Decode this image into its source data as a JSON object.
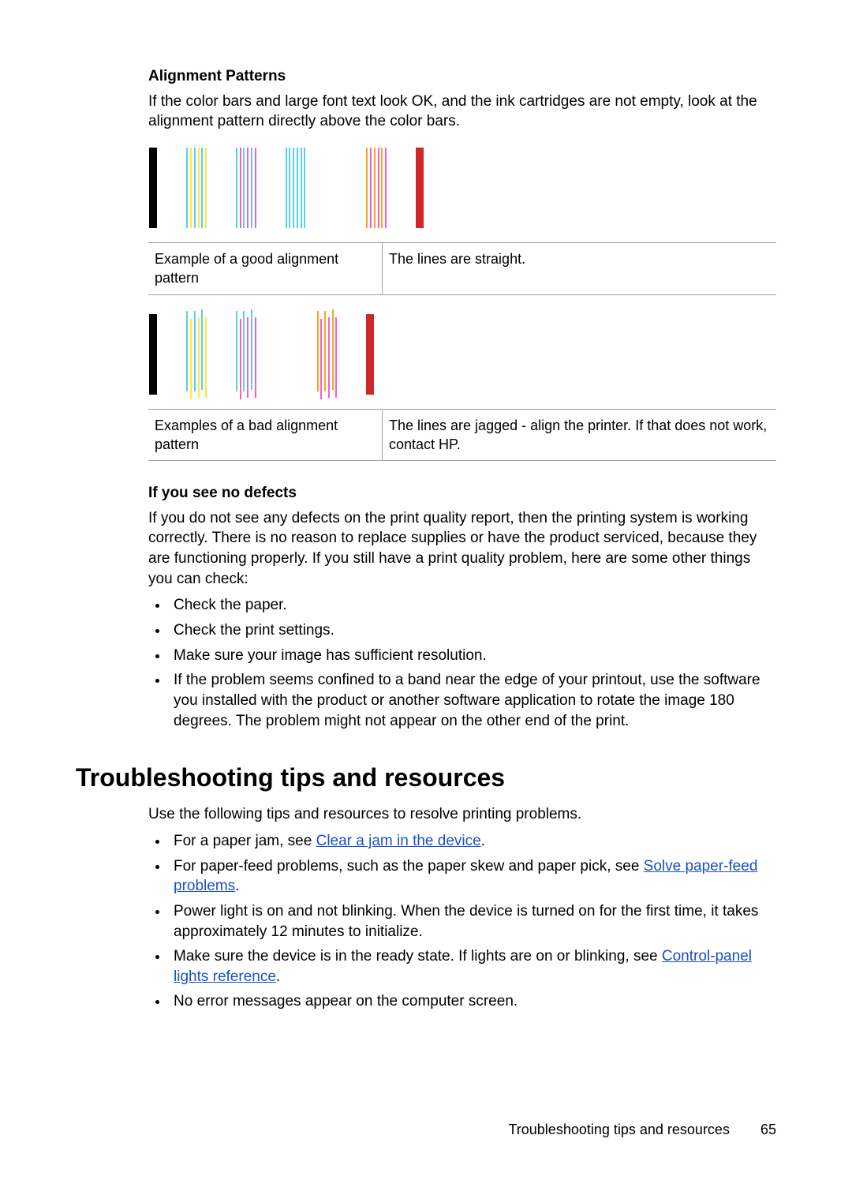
{
  "section1": {
    "heading": "Alignment Patterns",
    "intro": "If the color bars and large font text look OK, and the ink cartridges are not empty, look at the alignment pattern directly above the color bars."
  },
  "good_table": {
    "left": "Example of a good alignment pattern",
    "right": "The lines are straight."
  },
  "bad_table": {
    "left": "Examples of a bad alignment pattern",
    "right": "The lines are jagged - align the printer. If that does not work, contact HP."
  },
  "section2": {
    "heading": "If you see no defects",
    "intro": "If you do not see any defects on the print quality report, then the printing system is working correctly. There is no reason to replace supplies or have the product serviced, because they are functioning properly. If you still have a print quality problem, here are some other things you can check:",
    "bullets": [
      "Check the paper.",
      "Check the print settings.",
      "Make sure your image has sufficient resolution.",
      "If the problem seems confined to a band near the edge of your printout, use the software you installed with the product or another software application to rotate the image 180 degrees. The problem might not appear on the other end of the print."
    ]
  },
  "title": "Troubleshooting tips and resources",
  "tips_intro": "Use the following tips and resources to resolve printing problems.",
  "tips": [
    {
      "pre": "For a paper jam, see ",
      "link": "Clear a jam in the device",
      "post": "."
    },
    {
      "pre": "For paper-feed problems, such as the paper skew and paper pick, see ",
      "link": "Solve paper-feed problems",
      "post": "."
    },
    {
      "pre": "Power light is on and not blinking. When the device is turned on for the first time, it takes approximately 12 minutes to initialize.",
      "link": "",
      "post": ""
    },
    {
      "pre": "Make sure the device is in the ready state. If lights are on or blinking, see ",
      "link": "Control-panel lights reference",
      "post": "."
    },
    {
      "pre": "No error messages appear on the computer screen.",
      "link": "",
      "post": ""
    }
  ],
  "footer": {
    "section": "Troubleshooting tips and resources",
    "page": "65"
  }
}
